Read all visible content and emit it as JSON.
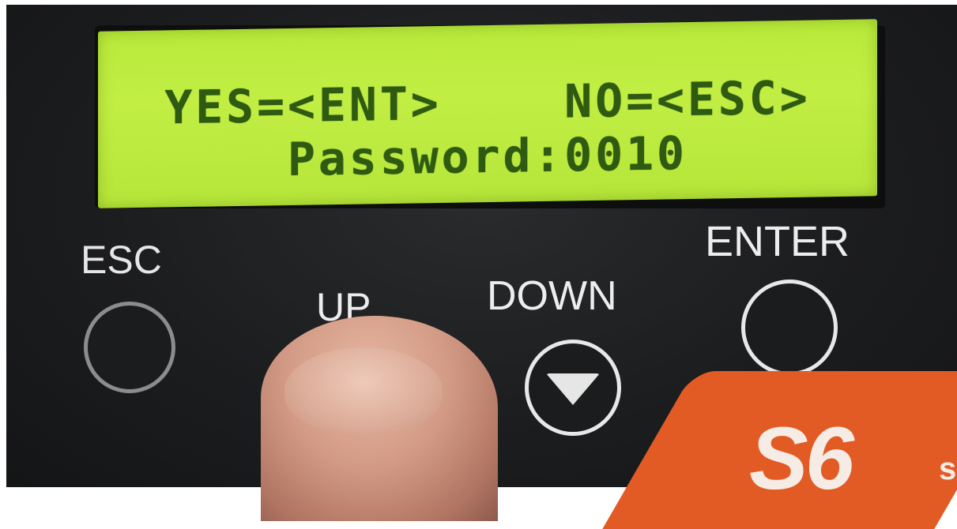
{
  "lcd": {
    "line1": "YES=<ENT>    NO=<ESC>",
    "line2": "Password:0010"
  },
  "buttons": {
    "esc_label": "ESC",
    "up_label": "UP",
    "down_label": "DOWN",
    "enter_label": "ENTER"
  },
  "logo": {
    "text": "S6",
    "suffix": "s"
  },
  "colors": {
    "lcd_background": "#c2ee44",
    "lcd_text": "#2f5a12",
    "panel": "#1c1d1f",
    "logo_orange": "#e25b25"
  },
  "icons": {
    "down_button": "triangle-down-icon"
  }
}
